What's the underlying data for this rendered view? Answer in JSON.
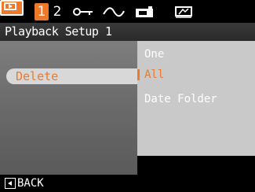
{
  "tabs": {
    "playback_icon": "playback-icon",
    "page1": "1",
    "page2": "2",
    "icons": [
      "key-icon",
      "wave-icon",
      "print-icon",
      "slideshow-icon"
    ]
  },
  "header": {
    "title": "Playback Setup 1"
  },
  "menu": {
    "items": [
      {
        "label": "Delete"
      }
    ]
  },
  "submenu": {
    "options": [
      {
        "label": "One"
      },
      {
        "label": "All"
      },
      {
        "label": "Date Folder"
      }
    ],
    "selected": "All"
  },
  "footer": {
    "back_label": "BACK"
  },
  "colors": {
    "accent": "#f0782a",
    "panel": "#c9c9c9",
    "background": "#000000"
  }
}
